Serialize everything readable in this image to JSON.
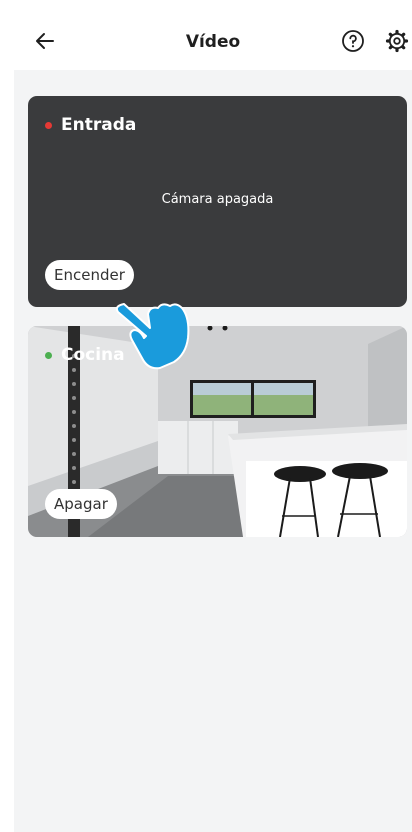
{
  "header": {
    "title": "Vídeo",
    "back_icon": "arrow-left-icon",
    "help_icon": "question-circle-icon",
    "settings_icon": "gear-icon"
  },
  "cameras": [
    {
      "name": "Entrada",
      "status_color": "#e53935",
      "status_text": "Cámara apagada",
      "action_label": "Encender"
    },
    {
      "name": "Cocina",
      "status_color": "#4caf50",
      "action_label": "Apagar"
    }
  ],
  "overlay": {
    "hand_icon": "pointing-hand-icon",
    "hand_color": "#1a9bdc"
  }
}
